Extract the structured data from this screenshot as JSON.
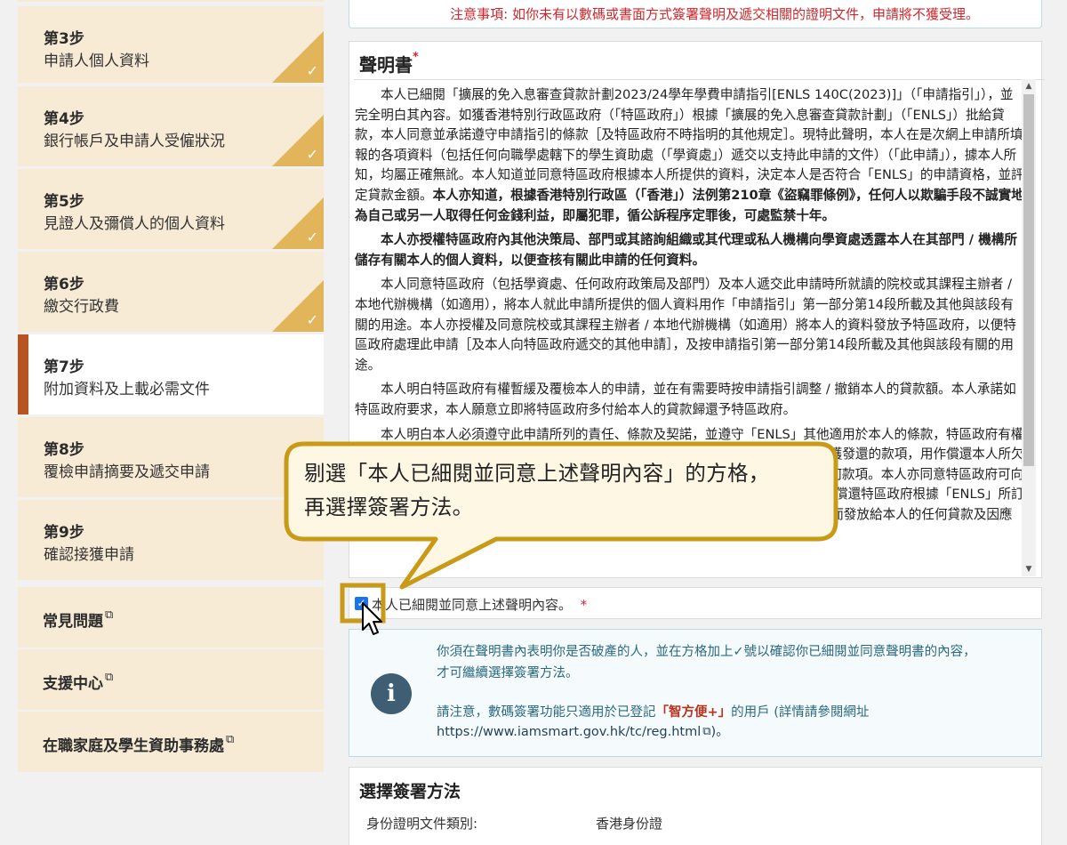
{
  "sidebar": {
    "steps": [
      {
        "num": "第3步",
        "label": "申請人個人資料"
      },
      {
        "num": "第4步",
        "label": "銀行帳戶及申請人受僱狀況"
      },
      {
        "num": "第5步",
        "label": "見證人及彌償人的個人資料"
      },
      {
        "num": "第6步",
        "label": "繳交行政費"
      },
      {
        "num": "第7步",
        "label": "附加資料及上載必需文件"
      },
      {
        "num": "第8步",
        "label": "覆檢申請摘要及遞交申請"
      },
      {
        "num": "第9步",
        "label": "確認接獲申請"
      }
    ],
    "done_check": "✓",
    "links": [
      {
        "label": "常見問題"
      },
      {
        "label": "支援中心"
      },
      {
        "label": "在職家庭及學生資助事務處"
      }
    ],
    "external_icon": "⧉"
  },
  "notice": {
    "text": "注意事項: 如你未有以數碼或書面方式簽署聲明及遞交相關的證明文件，申請將不獲受理。"
  },
  "declaration": {
    "title": "聲明書",
    "required_mark": "*",
    "p1_normal": "本人已細閱「擴展的免入息審查貸款計劃2023/24學年學費申請指引[ENLS 140C(2023)]」（「申請指引」），並完全明白其內容。如獲香港特別行政區政府（「特區政府」）根據「擴展的免入息審查貸款計劃」（「ENLS」）批給貸款，本人同意並承諾遵守申請指引的條款［及特區政府不時指明的其他規定］。現特此聲明，本人在是次網上申請所填報的各項資料（包括任何向職學處轄下的學生資助處（「學資處」）遞交以支持此申請的文件）（「此申請」），據本人所知，均屬正確無訛。本人知道並同意特區政府根據本人所提供的資料，決定本人是否符合「ENLS」的申請資格，並評定貸款金額。",
    "p1_bold": "本人亦知道，根據香港特別行政區（「香港」）法例第210章《盜竊罪條例》，任何人以欺騙手段不誠實地為自己或另一人取得任何金錢利益，即屬犯罪，循公訴程序定罪後，可處監禁十年。",
    "p2_bold": "本人亦授權特區政府內其他決策局、部門或其諮詢組織或其代理或私人機構向學資處透露本人在其部門 / 機構所儲存有關本人的個人資料，以便查核有關此申請的任何資料。",
    "p3": "本人同意特區政府（包括學資處、任何政府政策局及部門）及本人遞交此申請時所就讀的院校或其課程主辦者 / 本地代辦機構（如適用），將本人就此申請所提供的個人資料用作「申請指引」第一部分第14段所載及其他與該段有關的用途。本人亦授權及同意院校或其課程主辦者 / 本地代辦機構（如適用）將本人的資料發放予特區政府，以便特區政府處理此申請［及本人向特區政府遞交的其他申請］，及按申請指引第一部分第14段所載及其他與該段有關的用途。",
    "p4": "本人明白特區政府有權暫緩及覆檢本人的申請，並在有需要時按申請指引調整 / 撤銷本人的貸款額。本人承諾如特區政府要求，本人願意立即將特區政府多付給本人的貸款歸還予特區政府。",
    "p5": "本人明白本人必須遵守此申請所列的責任、條款及契諾，並遵守「ENLS」其他適用於本人的條款，特區政府有權按照申請指引，追討本人因在「ENLS」所報讀的課程或本人就讀的院校或其課程而獲發還的款項，用作償還本人所欠特區政府的貸款，並因應本人就「ENLS」所引致的費用而要求本人繳付 / 償還的任何款項。本人亦同意特區政府可向本人就讀的院校或其課程主辦者收回本人的學費發還，如有，視屬何情況而定）用作償還特區政府根據「ENLS」所訂的條款就「應用教育文憑」/「毅進文憑」/「指定夜間成人教育課程資助計劃」課程而發放給本人的任何貸款及因應該些貸款而要求本人繳付 / 償還的任何款項。"
  },
  "agree": {
    "checked": true,
    "label": "本人已細閱並同意上述聲明內容。",
    "required_mark": "*"
  },
  "info": {
    "icon": "i",
    "line1a": "你須在聲明書內表明你是否破產的人，並在方格加上",
    "tick": "✓",
    "line1b": "號以確認你已細閱並同意聲明書的內容，",
    "line2": "才可繼續選擇簽署方法。",
    "line3a": "請注意，數碼簽署功能只適用於已登記",
    "iamsmart": "「智方便+」",
    "line3b": "的用戶 (詳情請參閱網址",
    "url": "https://www.iamsmart.gov.hk/tc/reg.html",
    "line4_end": ")。"
  },
  "signing": {
    "title": "選擇簽署方法",
    "id_type_label": "身份證明文件類別:",
    "id_type_value": "香港身份證"
  },
  "tutorial": {
    "callout_line1": "剔選「本人已細閱並同意上述聲明內容」的方格，",
    "callout_line2": "再選擇簽署方法。",
    "highlight_color": "#c89a16"
  }
}
